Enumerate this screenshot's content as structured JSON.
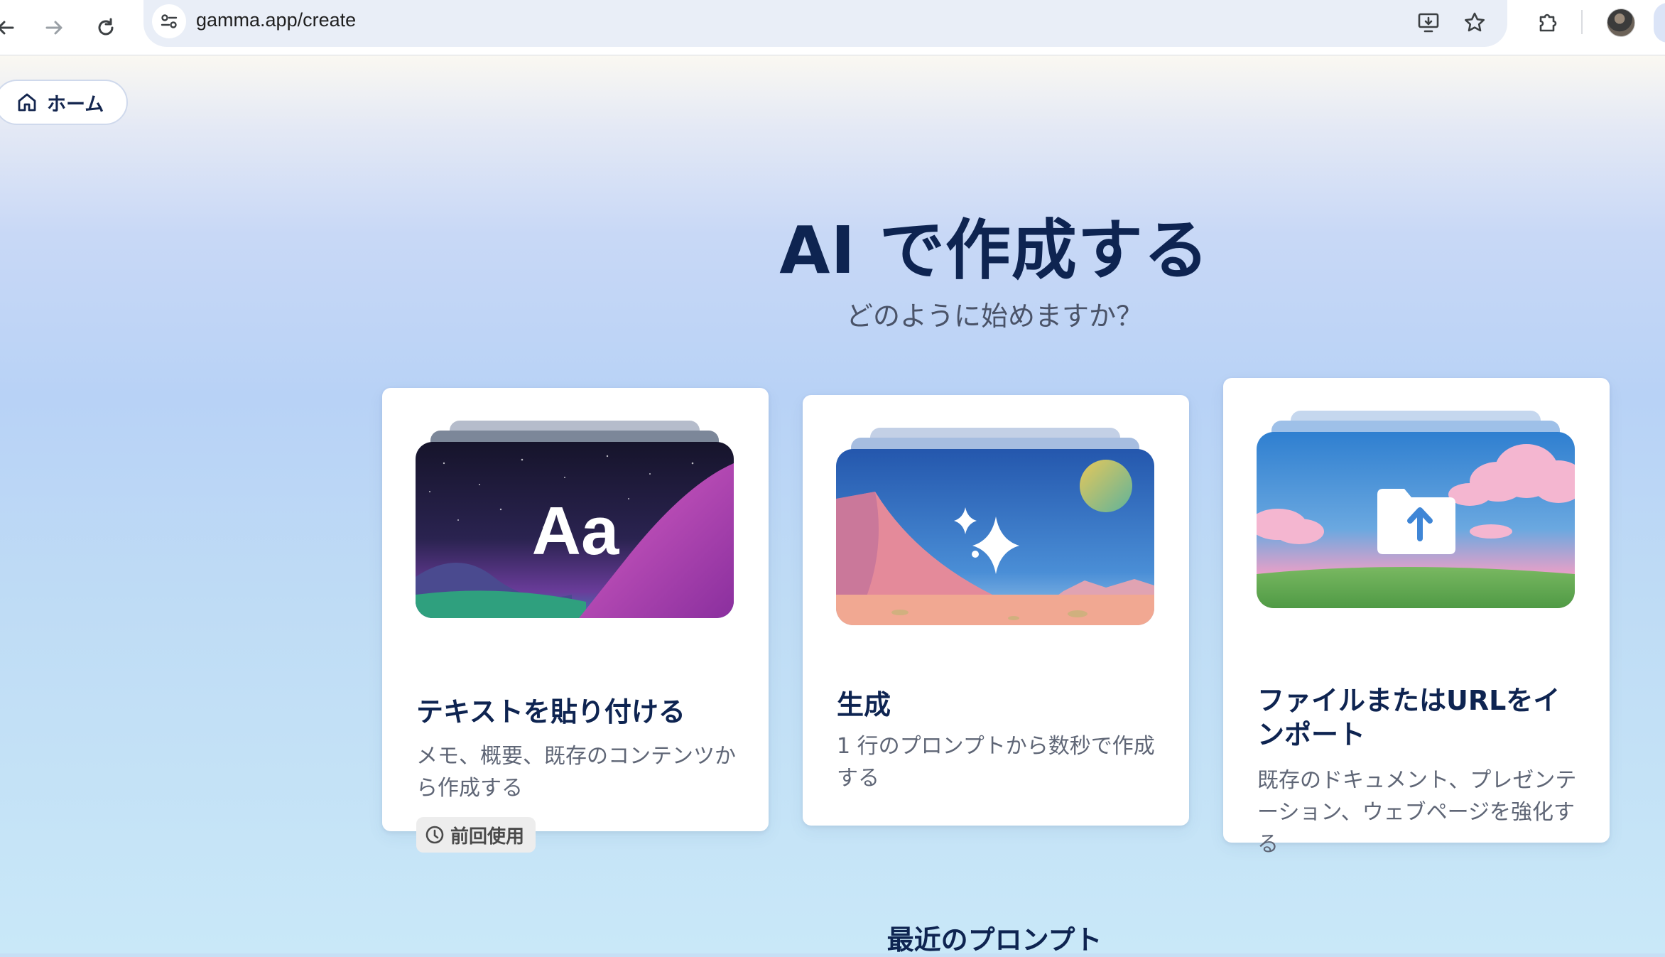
{
  "browser": {
    "url": "gamma.app/create",
    "icons": [
      "back-arrow-icon",
      "forward-arrow-icon",
      "reload-icon",
      "site-info-icon",
      "install-app-icon",
      "bookmark-star-icon",
      "extensions-icon",
      "profile-avatar"
    ]
  },
  "page": {
    "home_label": "ホーム",
    "headline": "AI で作成する",
    "subline": "どのように始めますか？",
    "recent_heading": "最近のプロンプト"
  },
  "cards": [
    {
      "title": "テキストを貼り付ける",
      "description": "メモ、概要、既存のコンテンツから作成する",
      "badge": "前回使用",
      "thumb_text": "Aa",
      "thumb_icon": "text-aa-icon"
    },
    {
      "title": "生成",
      "description": "1 行のプロンプトから数秒で作成する",
      "thumb_icon": "sparkle-icon"
    },
    {
      "title": "ファイルまたはURLをインポート",
      "description": "既存のドキュメント、プレゼンテーション、ウェブページを強化する",
      "thumb_icon": "upload-folder-icon"
    }
  ],
  "colors": {
    "heading": "#0e2451",
    "body_text": "#5f6676",
    "card_bg": "#ffffff"
  }
}
